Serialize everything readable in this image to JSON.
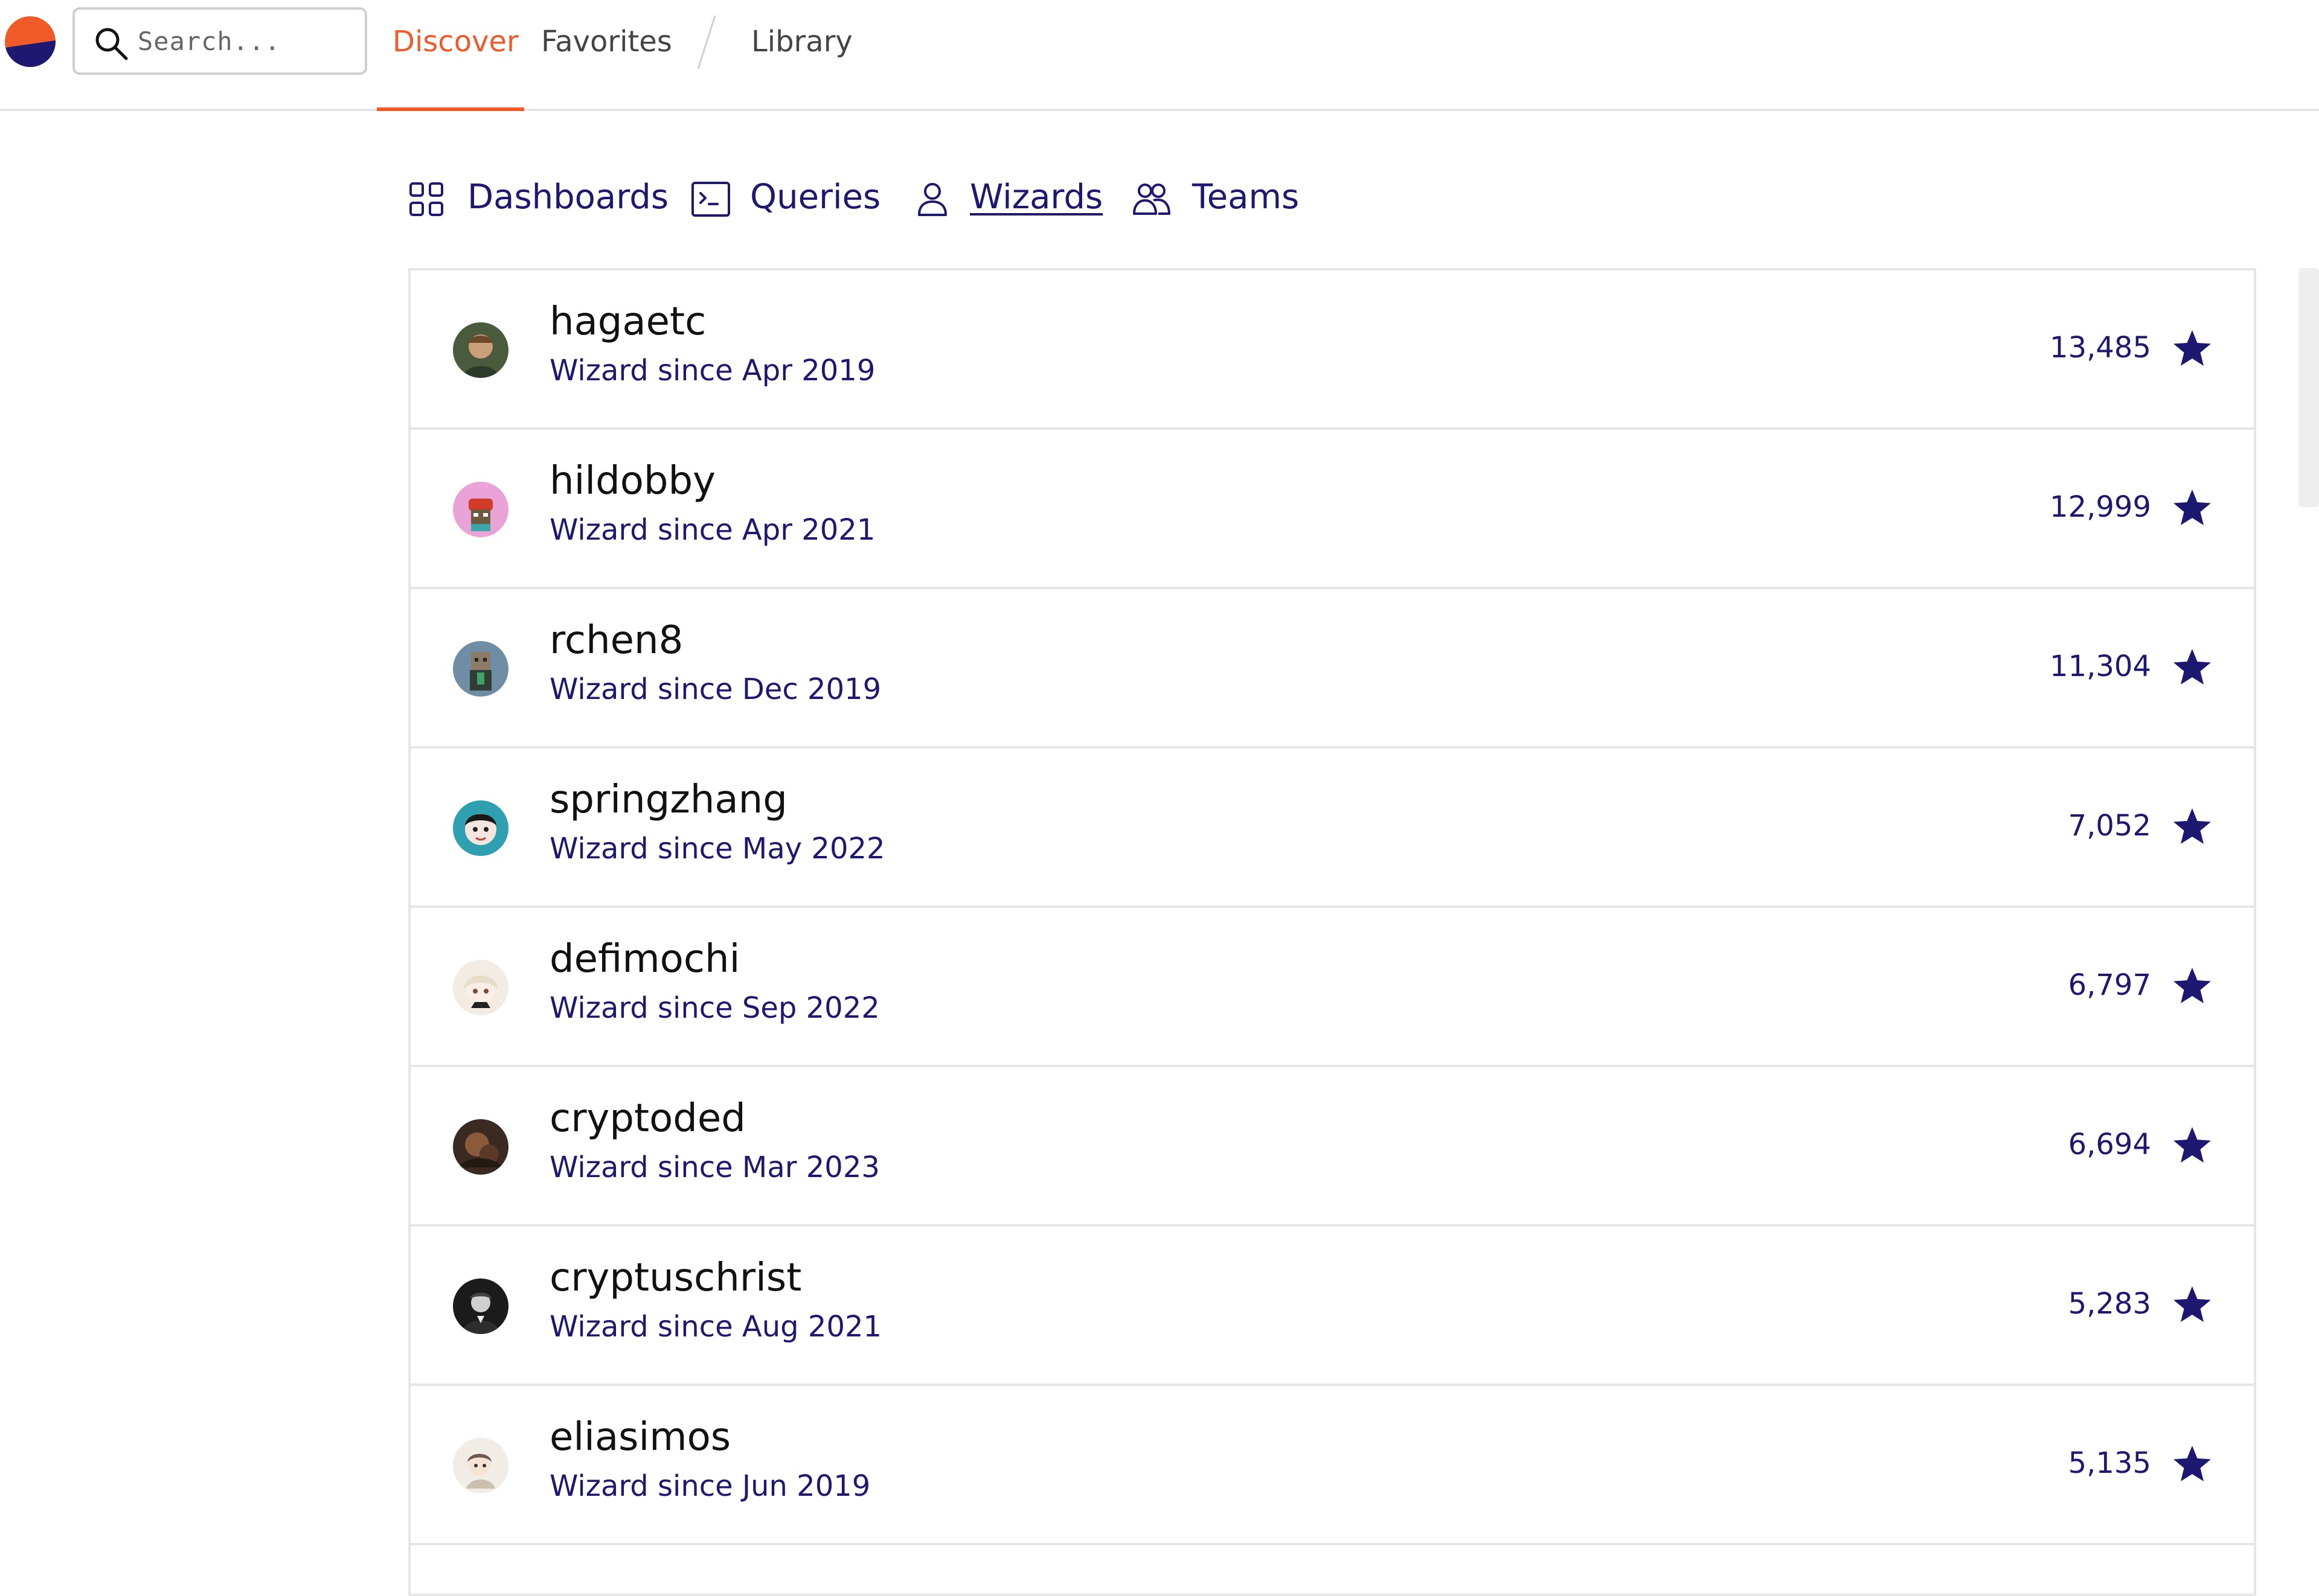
{
  "search": {
    "placeholder": "Search..."
  },
  "topnav": {
    "discover": "Discover",
    "favorites": "Favorites",
    "library": "Library"
  },
  "subtabs": {
    "dashboards": "Dashboards",
    "queries": "Queries",
    "wizards": "Wizards",
    "teams": "Teams"
  },
  "colors": {
    "accent": "#f05a28",
    "brand_navy": "#1e1870",
    "text": "#111111"
  },
  "wizards": [
    {
      "name": "hagaetc",
      "since": "Wizard since Apr 2019",
      "stars": "13,485"
    },
    {
      "name": "hildobby",
      "since": "Wizard since Apr 2021",
      "stars": "12,999"
    },
    {
      "name": "rchen8",
      "since": "Wizard since Dec 2019",
      "stars": "11,304"
    },
    {
      "name": "springzhang",
      "since": "Wizard since May 2022",
      "stars": "7,052"
    },
    {
      "name": "defimochi",
      "since": "Wizard since Sep 2022",
      "stars": "6,797"
    },
    {
      "name": "cryptoded",
      "since": "Wizard since Mar 2023",
      "stars": "6,694"
    },
    {
      "name": "cryptuschrist",
      "since": "Wizard since Aug 2021",
      "stars": "5,283"
    },
    {
      "name": "eliasimos",
      "since": "Wizard since Jun 2019",
      "stars": "5,135"
    }
  ]
}
